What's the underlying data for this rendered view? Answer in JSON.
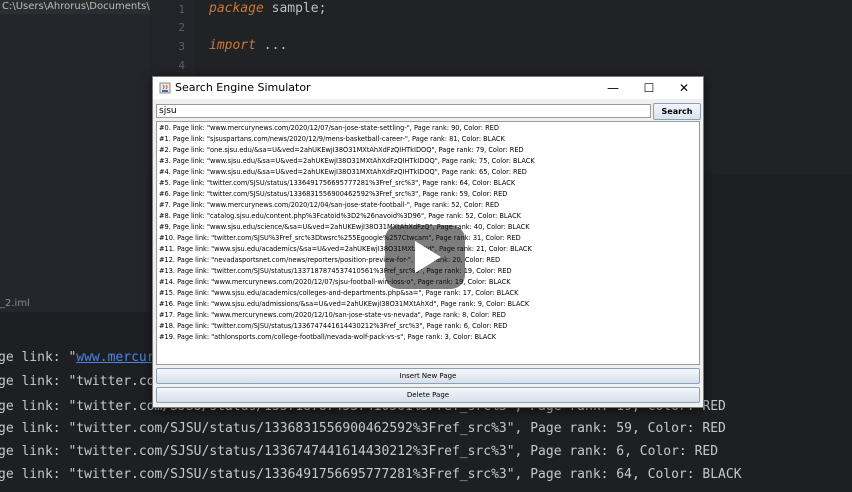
{
  "ide": {
    "path": "C:\\Users\\Ahrorus\\Documents\\SJSU",
    "line_numbers": [
      "1",
      "2",
      "3",
      "4"
    ],
    "code_lines": [
      {
        "kw": "package",
        "rest": " sample;"
      },
      {
        "kw": "import",
        "rest": " ..."
      }
    ],
    "project_file": "_2.iml",
    "project_sub": "jar",
    "console_lines": [
      {
        "prefix": "ge link: \"",
        "link": "www.mercury",
        "rest": ""
      },
      {
        "prefix": "ge link: \"twitter.com",
        "link": "",
        "rest": ""
      },
      {
        "prefix": "ge link: \"twitter.com/SJSU/status/1337187874537410561%3Fref_src%3\", Page rank: 19, Color: RED",
        "link": "",
        "rest": ""
      },
      {
        "prefix": "ge link: \"twitter.com/SJSU/status/1336831556900462592%3Fref_src%3\", Page rank: 59, Color: RED",
        "link": "",
        "rest": ""
      },
      {
        "prefix": "ge link: \"twitter.com/SJSU/status/1336747441614430212%3Fref_src%3\", Page rank: 6, Color: RED",
        "link": "",
        "rest": ""
      },
      {
        "prefix": "ge link: \"twitter.com/SJSU/status/1336491756695777281%3Fref_src%3\", Page rank: 64, Color: BLACK",
        "link": "",
        "rest": ""
      }
    ]
  },
  "dialog": {
    "title": "Search Engine Simulator",
    "window_controls": {
      "minimize": "—",
      "maximize": "☐",
      "close": "✕"
    },
    "search": {
      "value": "sjsu",
      "button_label": "Search"
    },
    "results": [
      "#0. Page link: \"www.mercurynews.com/2020/12/07/san-jose-state-settling-\", Page rank: 90, Color: RED",
      "#1. Page link: \"sjsuspartans.com/news/2020/12/9/mens-basketball-career-\", Page rank: 81, Color: BLACK",
      "#2. Page link: \"one.sjsu.edu/&sa=U&ved=2ahUKEwjI38O31MXtAhXdFzQIHTkIDOQ\", Page rank: 79, Color: RED",
      "#3. Page link: \"www.sjsu.edu/&sa=U&ved=2ahUKEwjI38O31MXtAhXdFzQIHTkIDOQ\", Page rank: 75, Color: BLACK",
      "#4. Page link: \"www.sjsu.edu/&sa=U&ved=2ahUKEwjI38O31MXtAhXdFzQIHTkIDOQ\", Page rank: 65, Color: RED",
      "#5. Page link: \"twitter.com/SJSU/status/1336491756695777281%3Fref_src%3\", Page rank: 64, Color: BLACK",
      "#6. Page link: \"twitter.com/SJSU/status/1336831556900462592%3Fref_src%3\", Page rank: 59, Color: RED",
      "#7. Page link: \"www.mercurynews.com/2020/12/04/san-jose-state-football-\", Page rank: 52, Color: RED",
      "#8. Page link: \"catalog.sjsu.edu/content.php%3Fcatoid%3D2%26navoid%3D96\", Page rank: 52, Color: BLACK",
      "#9. Page link: \"www.sjsu.edu/science/&sa=U&ved=2ahUKEwjI38O31MXtAhXdFzQ\", Page rank: 40, Color: BLACK",
      "#10. Page link: \"twitter.com/SJSU%3Fref_src%3Dtwsrc%255Egoogle%257Ctwcam\", Page rank: 31, Color: RED",
      "#11. Page link: \"www.sjsu.edu/academics/&sa=U&ved=2ahUKEwjI38O31MXtAhXd\", Page rank: 21, Color: BLACK",
      "#12. Page link: \"nevadasportsnet.com/news/reporters/position-preview-for-\", Page rank: 20, Color: RED",
      "#13. Page link: \"twitter.com/SJSU/status/1337187874537410561%3Fref_src%3\", Page rank: 19, Color: RED",
      "#14. Page link: \"www.mercurynews.com/2020/12/07/sjsu-football-win-loss-o\", Page rank: 19, Color: BLACK",
      "#15. Page link: \"www.sjsu.edu/academics/colleges-and-departments.php&sa=\", Page rank: 17, Color: BLACK",
      "#16. Page link: \"www.sjsu.edu/admissions/&sa=U&ved=2ahUKEwjI38O31MXtAhXd\", Page rank: 9, Color: BLACK",
      "#17. Page link: \"www.mercurynews.com/2020/12/10/san-jose-state-vs-nevada\", Page rank: 8, Color: RED",
      "#18. Page link: \"twitter.com/SJSU/status/1336747441614430212%3Fref_src%3\", Page rank: 6, Color: RED",
      "#19. Page link: \"athlonsports.com/college-football/nevada-wolf-pack-vs-s\", Page rank: 3, Color: BLACK"
    ],
    "insert_button": "Insert New Page",
    "delete_button": "Delete Page"
  },
  "colors": {
    "keyword": "#cc7832",
    "link": "#4a86e8",
    "button_border": "#8a9fb8"
  }
}
